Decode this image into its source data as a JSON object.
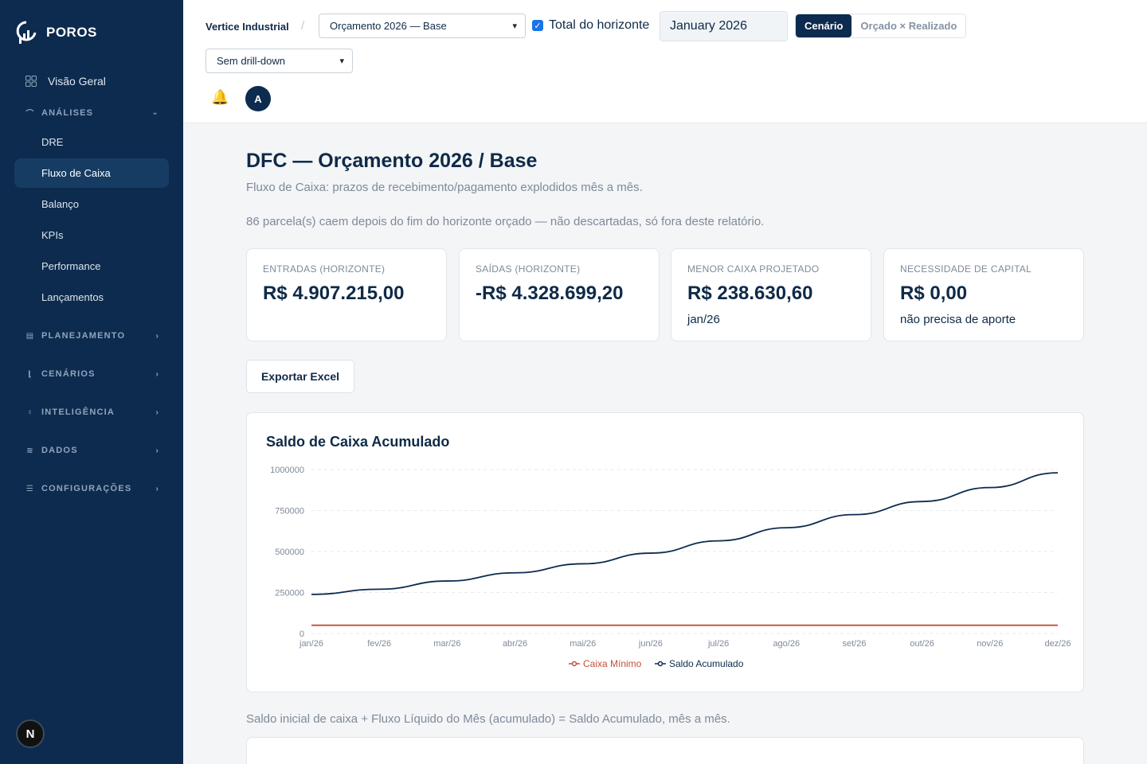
{
  "sidebar": {
    "brand": "POROS",
    "overview_label": "Visão Geral",
    "sections": [
      {
        "label": "ANÁLISES",
        "icon": "analytics-icon",
        "expanded": true
      },
      {
        "label": "PLANEJAMENTO",
        "icon": "document-icon"
      },
      {
        "label": "CENÁRIOS",
        "icon": "branch-icon"
      },
      {
        "label": "INTELIGÊNCIA",
        "icon": "lightbulb-icon"
      },
      {
        "label": "DADOS",
        "icon": "database-icon"
      },
      {
        "label": "CONFIGURAÇÕES",
        "icon": "sliders-icon"
      }
    ],
    "analises_items": [
      "DRE",
      "Fluxo de Caixa",
      "Balanço",
      "KPIs",
      "Performance",
      "Lançamentos"
    ],
    "active_item": "Fluxo de Caixa",
    "user_initial": "N"
  },
  "topbar": {
    "company": "Vertice Industrial",
    "budget_select": "Orçamento 2026 — Base",
    "horizon_checkbox_label": "Total do horizonte",
    "horizon_checked": true,
    "month": "January 2026",
    "mode_options": [
      "Cenário",
      "Orçado × Realizado"
    ],
    "mode_active": "Cenário",
    "drilldown_select": "Sem drill-down",
    "avatar_initial": "A"
  },
  "main": {
    "title": "DFC — Orçamento 2026 / Base",
    "subtitle": "Fluxo de Caixa: prazos de recebimento/pagamento explodidos mês a mês.",
    "notice": "86 parcela(s) caem depois do fim do horizonte orçado — não descartadas, só fora deste relatório.",
    "cards": [
      {
        "label": "ENTRADAS (HORIZONTE)",
        "value": "R$ 4.907.215,00",
        "sub": ""
      },
      {
        "label": "SAÍDAS (HORIZONTE)",
        "value": "-R$ 4.328.699,20",
        "sub": ""
      },
      {
        "label": "MENOR CAIXA PROJETADO",
        "value": "R$ 238.630,60",
        "sub": "jan/26"
      },
      {
        "label": "NECESSIDADE DE CAPITAL",
        "value": "R$ 0,00",
        "sub": "não precisa de aporte"
      }
    ],
    "export_label": "Exportar Excel",
    "footnote": "Saldo inicial de caixa + Fluxo Líquido do Mês (acumulado) = Saldo Acumulado, mês a mês."
  },
  "colors": {
    "navy": "#0d2b4e",
    "red": "#c0503a",
    "accent_blue": "#1a73e8",
    "bell": "#d9a520"
  },
  "chart_data": {
    "type": "line",
    "title": "Saldo de Caixa Acumulado",
    "categories": [
      "jan/26",
      "fev/26",
      "mar/26",
      "abr/26",
      "mai/26",
      "jun/26",
      "jul/26",
      "ago/26",
      "set/26",
      "out/26",
      "nov/26",
      "dez/26"
    ],
    "yticks": [
      "0",
      "250000",
      "500000",
      "750000",
      "1000000"
    ],
    "ylim": [
      0,
      1000000
    ],
    "series": [
      {
        "name": "Caixa Mínimo",
        "color": "#c0503a",
        "values": [
          50000,
          50000,
          50000,
          50000,
          50000,
          50000,
          50000,
          50000,
          50000,
          50000,
          50000,
          50000
        ]
      },
      {
        "name": "Saldo Acumulado",
        "color": "#0d2b4e",
        "values": [
          238630.6,
          270000,
          320000,
          370000,
          425000,
          490000,
          565000,
          645000,
          725000,
          805000,
          890000,
          980000
        ]
      }
    ],
    "grid": true,
    "legend": "bottom-center"
  }
}
